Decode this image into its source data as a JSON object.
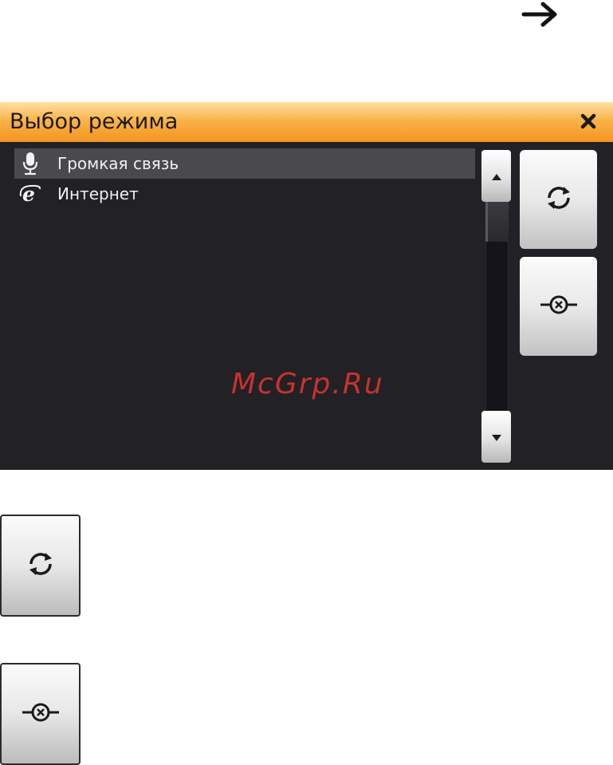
{
  "dialog": {
    "title": "Выбор режима",
    "close_icon": "close-icon",
    "items": [
      {
        "label": "Громкая связь",
        "icon": "microphone-icon",
        "selected": true
      },
      {
        "label": "Интернет",
        "icon": "internet-explorer-icon",
        "selected": false
      }
    ],
    "scroll_up_icon": "triangle-up-icon",
    "scroll_down_icon": "triangle-down-icon",
    "refresh_icon": "refresh-icon",
    "disconnect_icon": "disconnect-icon"
  },
  "watermark": "McGrp.Ru",
  "page": {
    "arrow_icon": "arrow-right-icon"
  },
  "colors": {
    "titlebar_top": "#fde2a4",
    "titlebar_bottom": "#f39420",
    "dialog_bg": "#222125",
    "selected_row": "#4a494e",
    "watermark": "#c8322e"
  }
}
